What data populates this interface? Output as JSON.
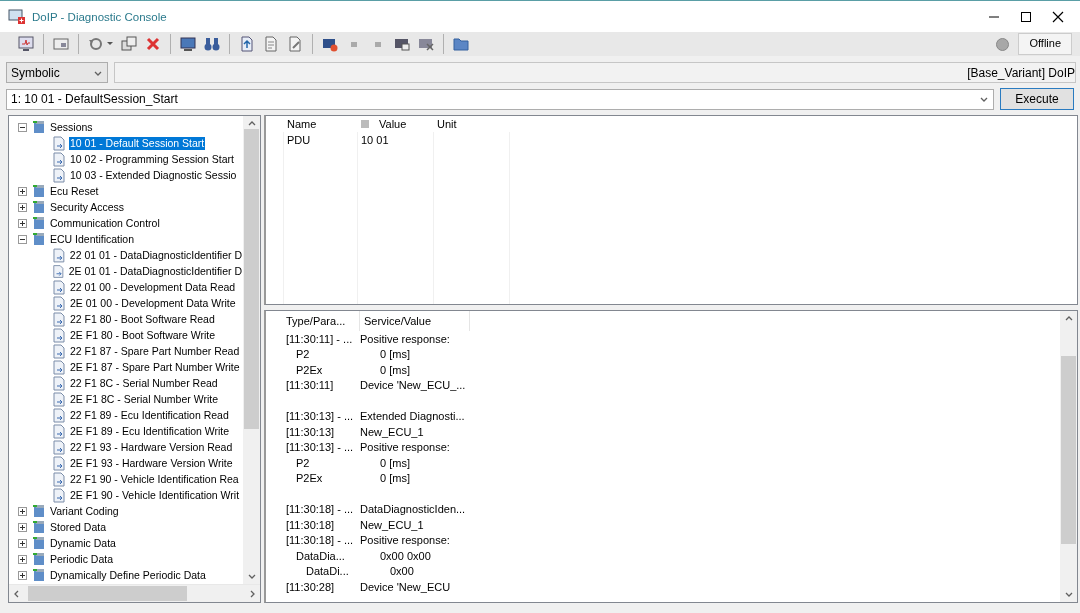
{
  "window": {
    "title": "DoIP - Diagnostic Console"
  },
  "status": {
    "label": "Offline",
    "online": false
  },
  "view_mode": {
    "value": "Symbolic"
  },
  "variant_field": {
    "value": "[Base_Variant] DoIP"
  },
  "service_combo": {
    "value": "1: 10 01 - DefaultSession_Start"
  },
  "execute_button": {
    "label": "Execute"
  },
  "tree": [
    {
      "label": "Sessions",
      "kind": "folder",
      "expanded": true,
      "selected": false,
      "children": [
        {
          "label": "10 01 - Default Session Start",
          "kind": "service",
          "selected": true
        },
        {
          "label": "10 02 - Programming Session Start",
          "kind": "service",
          "selected": false
        },
        {
          "label": "10 03 - Extended Diagnostic Sessio",
          "kind": "service",
          "selected": false
        }
      ]
    },
    {
      "label": "Ecu Reset",
      "kind": "folder",
      "expanded": false,
      "selected": false
    },
    {
      "label": "Security Access",
      "kind": "folder",
      "expanded": false,
      "selected": false
    },
    {
      "label": "Communication Control",
      "kind": "folder",
      "expanded": false,
      "selected": false
    },
    {
      "label": "ECU Identification",
      "kind": "folder",
      "expanded": true,
      "selected": false,
      "children": [
        {
          "label": "22 01 01 - DataDiagnosticIdentifier D",
          "kind": "service",
          "selected": false
        },
        {
          "label": "2E 01 01 - DataDiagnosticIdentifier D",
          "kind": "service",
          "selected": false
        },
        {
          "label": "22 01 00 - Development Data Read",
          "kind": "service",
          "selected": false
        },
        {
          "label": "2E 01 00 - Development Data Write",
          "kind": "service",
          "selected": false
        },
        {
          "label": "22 F1 80 - Boot Software Read",
          "kind": "service",
          "selected": false
        },
        {
          "label": "2E F1 80 - Boot Software Write",
          "kind": "service",
          "selected": false
        },
        {
          "label": "22 F1 87 - Spare Part Number Read",
          "kind": "service",
          "selected": false
        },
        {
          "label": "2E F1 87 - Spare Part Number Write",
          "kind": "service",
          "selected": false
        },
        {
          "label": "22 F1 8C - Serial Number Read",
          "kind": "service",
          "selected": false
        },
        {
          "label": "2E F1 8C - Serial Number Write",
          "kind": "service",
          "selected": false
        },
        {
          "label": "22 F1 89 - Ecu Identification Read",
          "kind": "service",
          "selected": false
        },
        {
          "label": "2E F1 89 - Ecu Identification Write",
          "kind": "service",
          "selected": false
        },
        {
          "label": "22 F1 93 - Hardware Version Read",
          "kind": "service",
          "selected": false
        },
        {
          "label": "2E F1 93 - Hardware Version Write",
          "kind": "service",
          "selected": false
        },
        {
          "label": "22 F1 90 - Vehicle Identification Rea",
          "kind": "service",
          "selected": false
        },
        {
          "label": "2E F1 90 - Vehicle Identification Writ",
          "kind": "service",
          "selected": false
        }
      ]
    },
    {
      "label": "Variant Coding",
      "kind": "folder",
      "expanded": false,
      "selected": false
    },
    {
      "label": "Stored Data",
      "kind": "folder",
      "expanded": false,
      "selected": false
    },
    {
      "label": "Dynamic Data",
      "kind": "folder",
      "expanded": false,
      "selected": false
    },
    {
      "label": "Periodic Data",
      "kind": "folder",
      "expanded": false,
      "selected": false
    },
    {
      "label": "Dynamically Define Periodic Data",
      "kind": "folder",
      "expanded": false,
      "selected": false
    }
  ],
  "parameters": {
    "columns": [
      "Name",
      "Value",
      "Unit"
    ],
    "rows": [
      {
        "name": "PDU",
        "value": "10 01"
      }
    ]
  },
  "log": {
    "columns": [
      "Type/Para...",
      "Service/Value"
    ],
    "groups": [
      [
        {
          "type": "[11:30:11] - ...",
          "value": "Positive response:",
          "children": [
            {
              "type": "P2",
              "value": "0 [ms]"
            },
            {
              "type": "P2Ex",
              "value": "0 [ms]"
            }
          ]
        },
        {
          "type": "[11:30:11]",
          "value": "Device 'New_ECU_..."
        }
      ],
      [
        {
          "type": "[11:30:13] - ...",
          "value": "Extended Diagnosti..."
        },
        {
          "type": "[11:30:13]",
          "value": "New_ECU_1"
        },
        {
          "type": "[11:30:13] - ...",
          "value": "Positive response:",
          "children": [
            {
              "type": "P2",
              "value": "0 [ms]"
            },
            {
              "type": "P2Ex",
              "value": "0 [ms]"
            }
          ]
        }
      ],
      [
        {
          "type": "[11:30:18] - ...",
          "value": "DataDiagnosticIden..."
        },
        {
          "type": "[11:30:18]",
          "value": "New_ECU_1"
        },
        {
          "type": "[11:30:18] - ...",
          "value": "Positive response:",
          "children": [
            {
              "type": "DataDia...",
              "value": "0x00 0x00",
              "children": [
                {
                  "type": "DataDi...",
                  "value": "0x00"
                }
              ]
            }
          ]
        },
        {
          "type": "[11:30:28]",
          "value": "Device 'New_ECU"
        }
      ]
    ]
  }
}
